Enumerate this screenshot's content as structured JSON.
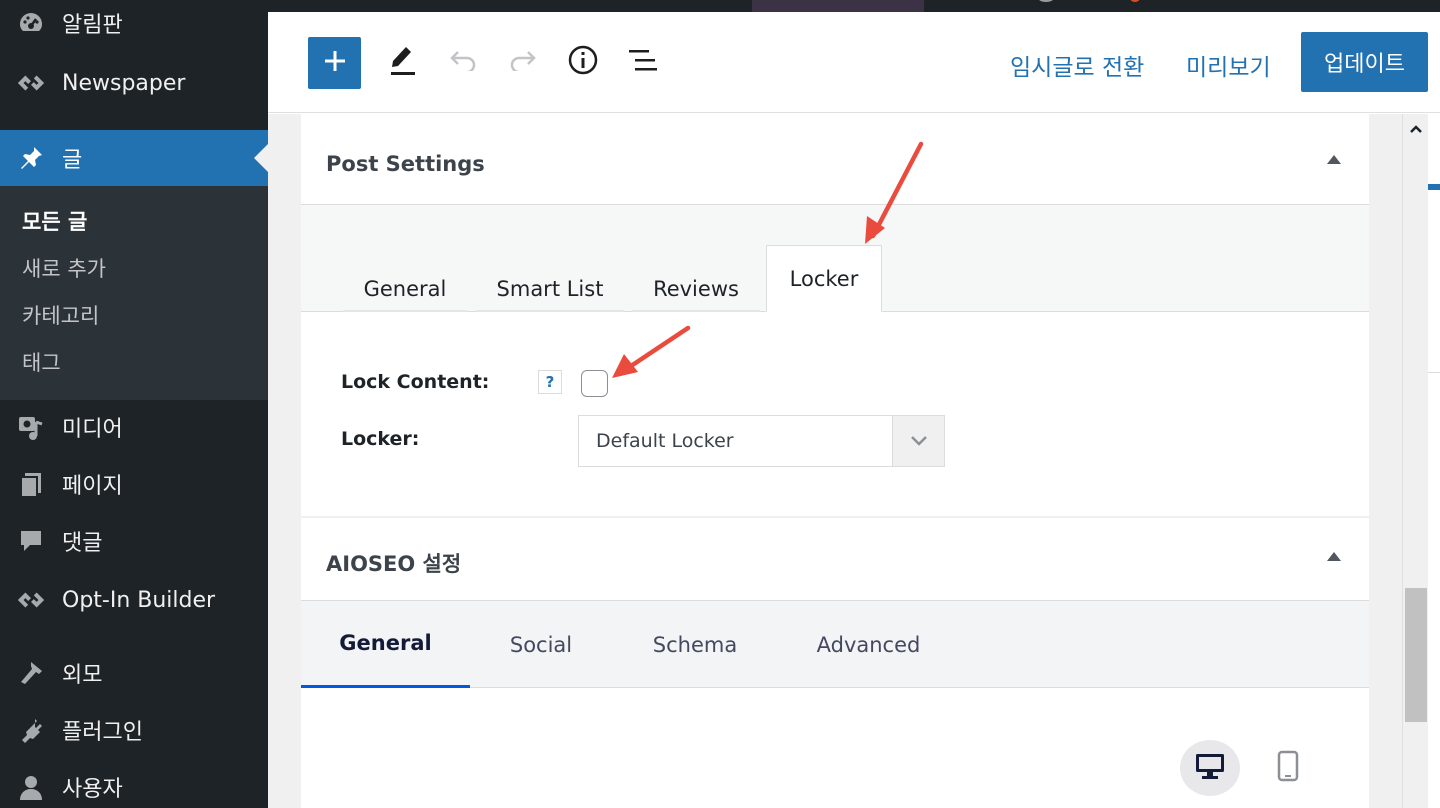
{
  "sidebar": {
    "items": [
      {
        "label": "알림판",
        "icon": "dashboard-icon"
      },
      {
        "label": "Newspaper",
        "icon": "newspaper-icon"
      },
      {
        "label": "글",
        "icon": "pin-icon"
      },
      {
        "label": "미디어",
        "icon": "media-icon"
      },
      {
        "label": "페이지",
        "icon": "pages-icon"
      },
      {
        "label": "댓글",
        "icon": "comments-icon"
      },
      {
        "label": "Opt-In Builder",
        "icon": "optin-icon"
      },
      {
        "label": "외모",
        "icon": "appearance-icon"
      },
      {
        "label": "플러그인",
        "icon": "plugins-icon"
      },
      {
        "label": "사용자",
        "icon": "users-icon"
      }
    ],
    "submenu": [
      "모든 글",
      "새로 추가",
      "카테고리",
      "태그"
    ]
  },
  "toolbar": {
    "draft_label": "임시글로 전환",
    "preview_label": "미리보기",
    "update_label": "업데이트"
  },
  "post_settings": {
    "title": "Post Settings",
    "tabs": [
      "General",
      "Smart List",
      "Reviews",
      "Locker"
    ],
    "lock_content_label": "Lock Content:",
    "help_label": "?",
    "locker_label": "Locker:",
    "locker_value": "Default Locker"
  },
  "aioseo": {
    "title": "AIOSEO 설정",
    "tabs": [
      "General",
      "Social",
      "Schema",
      "Advanced"
    ]
  },
  "colors": {
    "accent": "#2271b1",
    "annotation_arrow": "#e94b3c",
    "aioseo_tab_underline": "#005ae0"
  }
}
